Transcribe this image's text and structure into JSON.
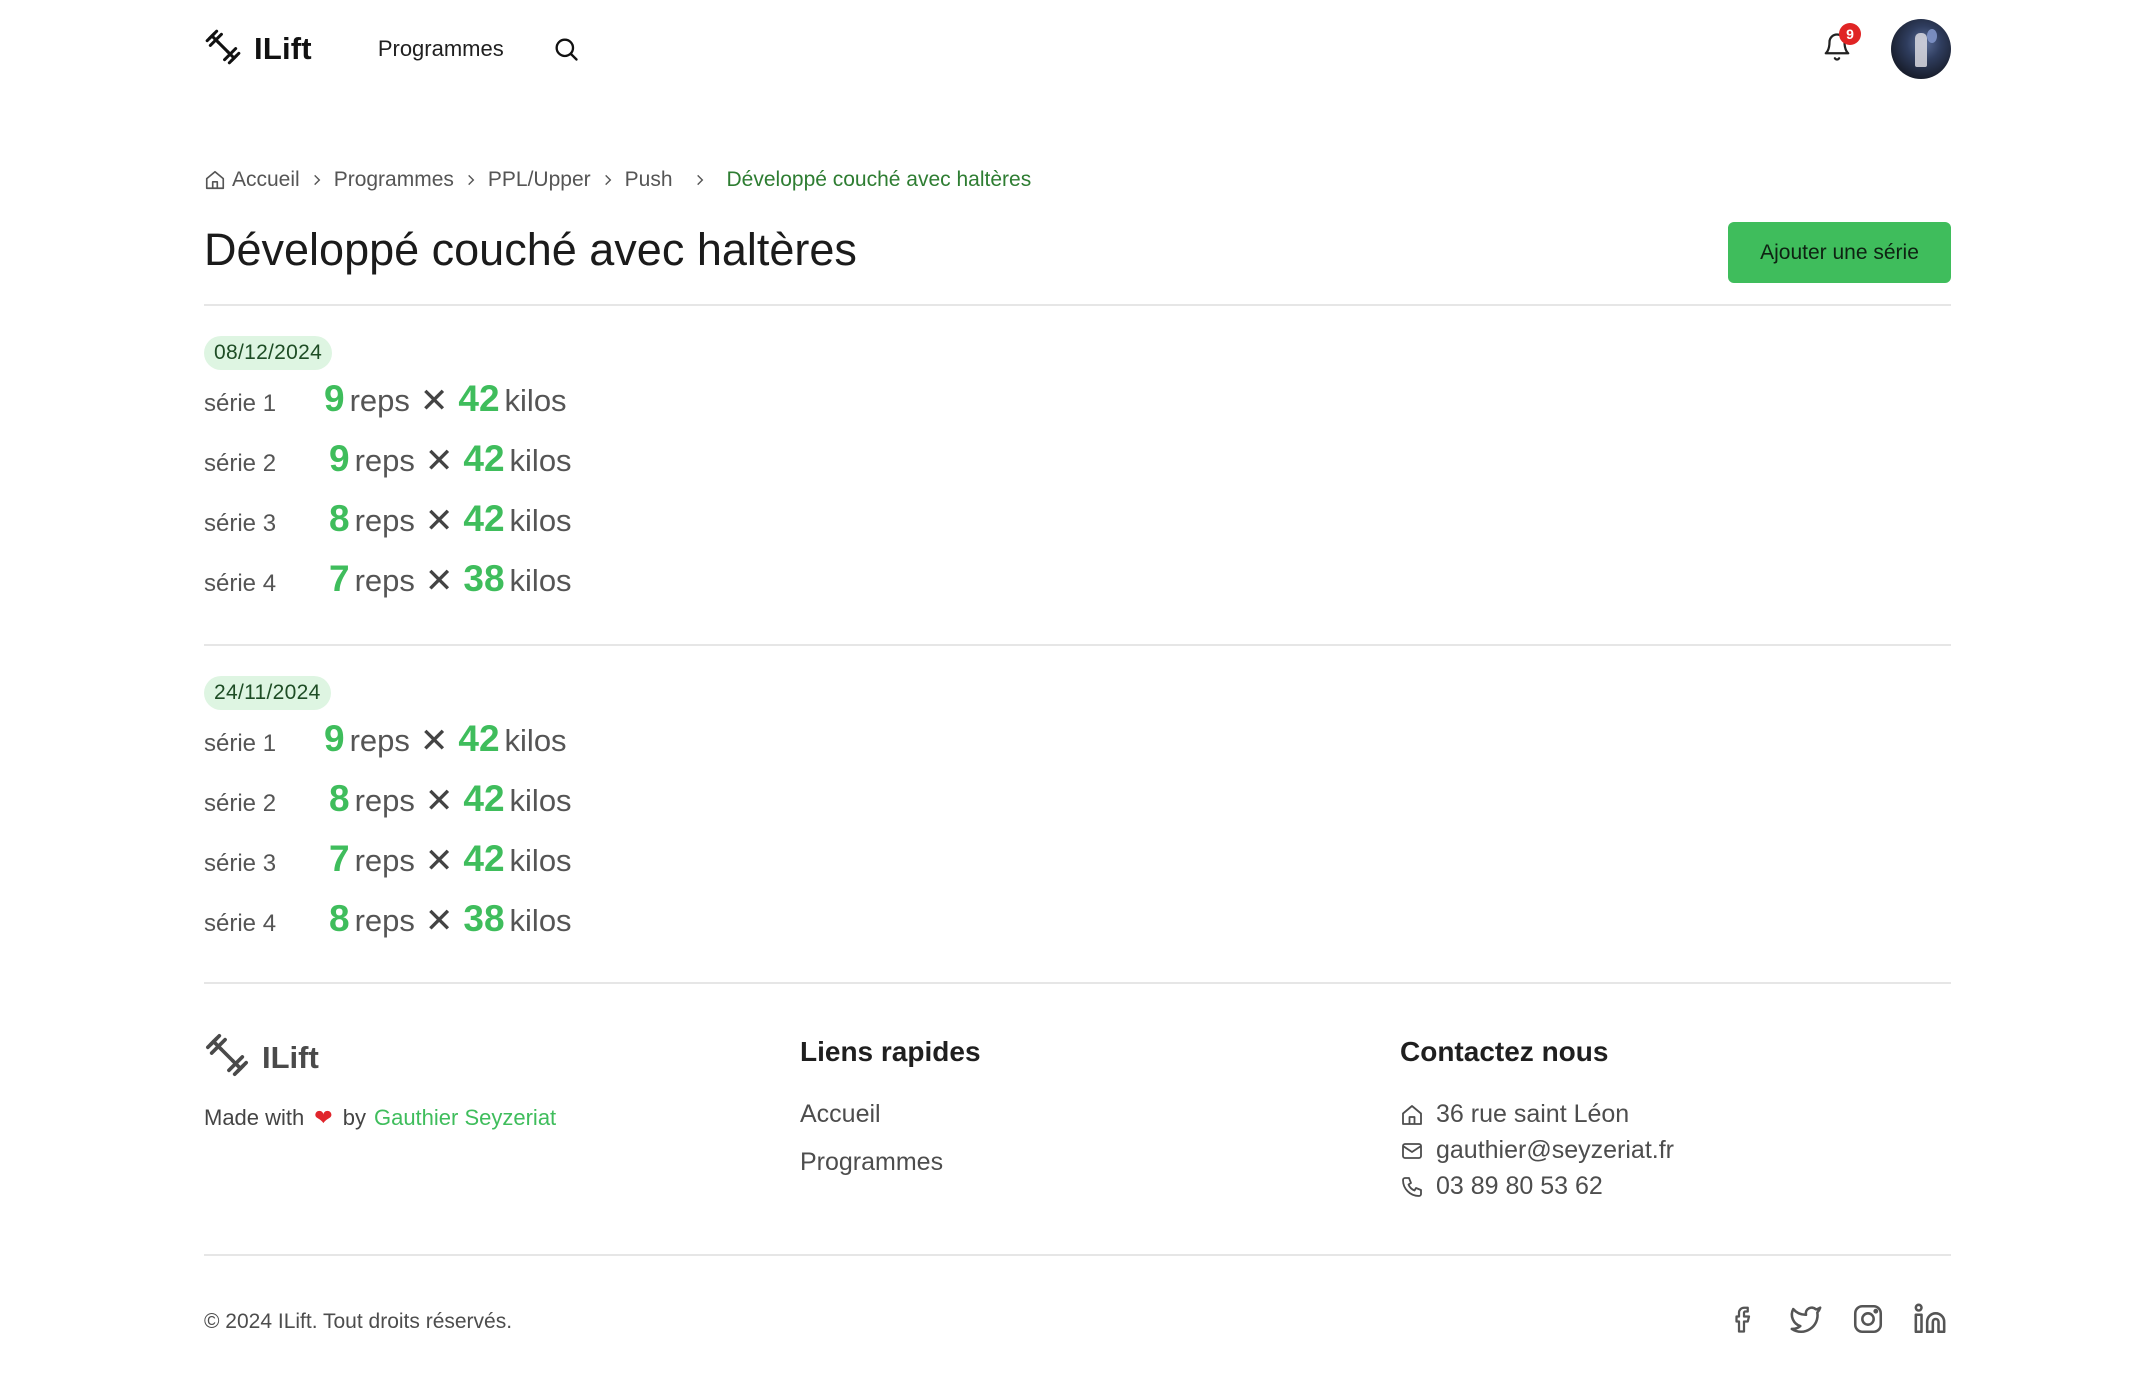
{
  "nav": {
    "brand": "ILift",
    "programmes_label": "Programmes",
    "notification_count": "9"
  },
  "breadcrumb": {
    "items": [
      "Accueil",
      "Programmes",
      "PPL/Upper",
      "Push"
    ],
    "current": "Développé couché avec haltères"
  },
  "page": {
    "title": "Développé couché avec haltères",
    "add_button": "Ajouter une série"
  },
  "sessions": [
    {
      "date": "08/12/2024",
      "sets": [
        {
          "label": "série 1",
          "reps": "9",
          "weight": "42"
        },
        {
          "label": "série 2",
          "reps": "9",
          "weight": "42"
        },
        {
          "label": "série 3",
          "reps": "8",
          "weight": "42"
        },
        {
          "label": "série 4",
          "reps": "7",
          "weight": "38"
        }
      ]
    },
    {
      "date": "24/11/2024",
      "sets": [
        {
          "label": "série 1",
          "reps": "9",
          "weight": "42"
        },
        {
          "label": "série 2",
          "reps": "8",
          "weight": "42"
        },
        {
          "label": "série 3",
          "reps": "7",
          "weight": "42"
        },
        {
          "label": "série 4",
          "reps": "8",
          "weight": "38"
        }
      ]
    }
  ],
  "units": {
    "reps": "reps",
    "weight": "kilos",
    "times": "✕"
  },
  "footer": {
    "brand": "ILift",
    "made_with": "Made with",
    "by": "by",
    "author": "Gauthier Seyzeriat",
    "quick_links_title": "Liens rapides",
    "quick_links": [
      "Accueil",
      "Programmes"
    ],
    "contact_title": "Contactez nous",
    "address": "36 rue saint Léon",
    "email": "gauthier@seyzeriat.fr",
    "phone": "03 89 80 53 62",
    "copyright": "© 2024 ILift. Tout droits réservés."
  },
  "colors": {
    "accent": "#3fbd5c",
    "badge_bg": "#def5e2",
    "notification": "#e02424",
    "breadcrumb_current": "#2e7d32"
  },
  "icons": [
    "dumbbell-icon",
    "search-icon",
    "bell-icon",
    "home-icon",
    "chevron-right-icon",
    "mail-icon",
    "phone-icon",
    "heart-icon",
    "facebook-icon",
    "twitter-icon",
    "instagram-icon",
    "linkedin-icon"
  ]
}
